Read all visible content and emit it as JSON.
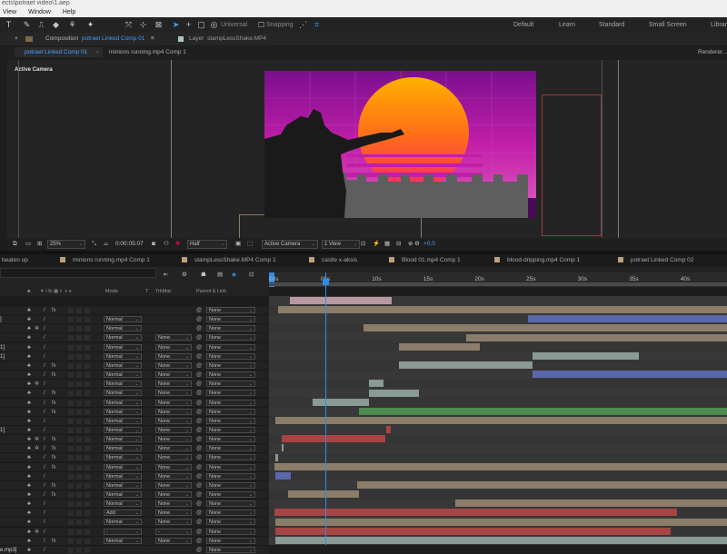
{
  "app": {
    "title": "ects\\potraet video\\1.aep",
    "menu": [
      "View",
      "Window",
      "Help"
    ]
  },
  "toolbar": {
    "universal_label": "Universal",
    "snapping_label": "Snapping",
    "workspaces": [
      "Default",
      "Learn",
      "Standard",
      "Small Screen",
      "Librar"
    ]
  },
  "panels": {
    "composition_tab": "Composition",
    "composition_name": "potraet Linked Comp 01",
    "layer_tab": "Layer",
    "layer_name": "stampLessShake.MP4",
    "sub_tabs": [
      "potraet Linked Comp 01",
      "minions running.mp4 Comp 1"
    ],
    "renderer": "Renderer..."
  },
  "viewer": {
    "active_camera_label": "Active Camera",
    "zoom": "25%",
    "timecode": "0:00:05:07",
    "resolution": "Half",
    "camera_select": "Active Camera",
    "view_select": "1 View",
    "exposure": "+0,0",
    "accent": "#2d8ceb"
  },
  "timeline": {
    "tabs": [
      "beaten up",
      "minions running.mp4 Comp 1",
      "stampLessShake.MP4 Comp 1",
      "castle x-aksis",
      "Blood 01.mp4 Comp 1",
      "blood-dripping.mp4 Comp 1",
      "potraet Linked Comp 02"
    ],
    "columns": {
      "mode": "Mode",
      "t": "T",
      "trkmat": "TrkMat",
      "parent": "Parent & Link"
    },
    "ruler_ticks": [
      "00s",
      "05s",
      "10s",
      "15s",
      "20s",
      "25s",
      "30s",
      "35s",
      "40s"
    ],
    "current_time_seconds": 5.2,
    "layers": [
      {
        "mode": "",
        "trkmat": "",
        "parent": "None",
        "left_label": "",
        "fx": true,
        "lock": false
      },
      {
        "mode": "Normal",
        "trkmat": "",
        "parent": "None",
        "left_label": "]",
        "fx": false,
        "lock": false
      },
      {
        "mode": "Normal",
        "trkmat": "",
        "parent": "None",
        "left_label": "",
        "fx": false,
        "lock": true
      },
      {
        "mode": "Normal",
        "trkmat": "None",
        "parent": "None",
        "left_label": "",
        "fx": false,
        "lock": false
      },
      {
        "mode": "Normal",
        "trkmat": "None",
        "parent": "None",
        "left_label": "1]",
        "fx": false,
        "lock": false
      },
      {
        "mode": "Normal",
        "trkmat": "None",
        "parent": "None",
        "left_label": "1]",
        "fx": false,
        "lock": false
      },
      {
        "mode": "Normal",
        "trkmat": "None",
        "parent": "None",
        "left_label": "",
        "fx": true,
        "lock": false
      },
      {
        "mode": "Normal",
        "trkmat": "None",
        "parent": "None",
        "left_label": "",
        "fx": true,
        "lock": false
      },
      {
        "mode": "Normal",
        "trkmat": "None",
        "parent": "None",
        "left_label": "",
        "fx": false,
        "lock": true
      },
      {
        "mode": "Normal",
        "trkmat": "None",
        "parent": "None",
        "left_label": "",
        "fx": true,
        "lock": false
      },
      {
        "mode": "Normal",
        "trkmat": "None",
        "parent": "None",
        "left_label": "",
        "fx": true,
        "lock": false
      },
      {
        "mode": "Normal",
        "trkmat": "None",
        "parent": "None",
        "left_label": "",
        "fx": true,
        "lock": false
      },
      {
        "mode": "Normal",
        "trkmat": "None",
        "parent": "None",
        "left_label": "",
        "fx": false,
        "lock": false
      },
      {
        "mode": "Normal",
        "trkmat": "None",
        "parent": "None",
        "left_label": "1]",
        "fx": false,
        "lock": false
      },
      {
        "mode": "Normal",
        "trkmat": "None",
        "parent": "None",
        "left_label": "",
        "fx": true,
        "lock": true
      },
      {
        "mode": "Normal",
        "trkmat": "None",
        "parent": "None",
        "left_label": "",
        "fx": true,
        "lock": true
      },
      {
        "mode": "Normal",
        "trkmat": "None",
        "parent": "None",
        "left_label": "",
        "fx": true,
        "lock": false
      },
      {
        "mode": "Normal",
        "trkmat": "None",
        "parent": "None",
        "left_label": "",
        "fx": true,
        "lock": false
      },
      {
        "mode": "Normal",
        "trkmat": "None",
        "parent": "None",
        "left_label": "",
        "fx": false,
        "lock": false
      },
      {
        "mode": "Normal",
        "trkmat": "None",
        "parent": "None",
        "left_label": "",
        "fx": true,
        "lock": false
      },
      {
        "mode": "Normal",
        "trkmat": "None",
        "parent": "None",
        "left_label": "",
        "fx": true,
        "lock": false
      },
      {
        "mode": "Normal",
        "trkmat": "None",
        "parent": "None",
        "left_label": "",
        "fx": false,
        "lock": false
      },
      {
        "mode": "Add",
        "trkmat": "None",
        "parent": "None",
        "left_label": "",
        "fx": false,
        "lock": false
      },
      {
        "mode": "Normal",
        "trkmat": "None",
        "parent": "None",
        "left_label": "",
        "fx": false,
        "lock": false
      },
      {
        "mode": "-",
        "trkmat": "-",
        "parent": "None",
        "left_label": "",
        "fx": false,
        "lock": true
      },
      {
        "mode": "Normal",
        "trkmat": "None",
        "parent": "None",
        "left_label": "",
        "fx": true,
        "lock": false
      },
      {
        "mode": "",
        "trkmat": "",
        "parent": "None",
        "left_label": "e.mp3]",
        "fx": false,
        "lock": false
      }
    ],
    "bars": [
      {
        "row": 0,
        "start": 1.7,
        "end": 11.6,
        "color": "#b898a0"
      },
      {
        "row": 1,
        "start": 0.5,
        "end": 45,
        "color": "#8b7d6a"
      },
      {
        "row": 2,
        "start": 24.8,
        "end": 45,
        "color": "#5968a8"
      },
      {
        "row": 3,
        "start": 8.8,
        "end": 45,
        "color": "#8b7d6a"
      },
      {
        "row": 4,
        "start": 18.8,
        "end": 45,
        "color": "#8b7d6a"
      },
      {
        "row": 5,
        "start": 12.3,
        "end": 20.2,
        "color": "#8b7d6a"
      },
      {
        "row": 6,
        "start": 25.3,
        "end": 35.6,
        "color": "#8a9a96"
      },
      {
        "row": 7,
        "start": 12.3,
        "end": 25.3,
        "color": "#8a9a96"
      },
      {
        "row": 8,
        "start": 25.3,
        "end": 45,
        "color": "#5968a8"
      },
      {
        "row": 9,
        "start": 9.4,
        "end": 10.8,
        "color": "#8a9a96"
      },
      {
        "row": 10,
        "start": 9.4,
        "end": 14.3,
        "color": "#8a9a96"
      },
      {
        "row": 11,
        "start": 3.9,
        "end": 9.4,
        "color": "#8a9a96"
      },
      {
        "row": 12,
        "start": 8.4,
        "end": 45,
        "color": "#4e8a4e"
      },
      {
        "row": 13,
        "start": 0.3,
        "end": 45,
        "color": "#8b7d6a"
      },
      {
        "row": 14,
        "start": 11,
        "end": 11.4,
        "color": "#a84444"
      },
      {
        "row": 15,
        "start": 0.9,
        "end": 11,
        "color": "#a84444"
      },
      {
        "row": 16,
        "start": 0.9,
        "end": 1.1,
        "color": "#8a9a96"
      },
      {
        "row": 17,
        "start": 0.3,
        "end": 0.6,
        "color": "#8a9a96"
      },
      {
        "row": 18,
        "start": 0.2,
        "end": 45,
        "color": "#8b7d6a"
      },
      {
        "row": 19,
        "start": 0.3,
        "end": 1.8,
        "color": "#5968a8"
      },
      {
        "row": 20,
        "start": 8.2,
        "end": 45,
        "color": "#8b7d6a"
      },
      {
        "row": 21,
        "start": 1.5,
        "end": 8.4,
        "color": "#8b7d6a"
      },
      {
        "row": 22,
        "start": 17.8,
        "end": 45,
        "color": "#8b7d6a"
      },
      {
        "row": 23,
        "start": 0.2,
        "end": 39.3,
        "color": "#a84444"
      },
      {
        "row": 24,
        "start": 0.3,
        "end": 45,
        "color": "#8b7d6a"
      },
      {
        "row": 25,
        "start": 0.3,
        "end": 38.7,
        "color": "#a84444"
      },
      {
        "row": 26,
        "start": 0.3,
        "end": 45,
        "color": "#8a9a96"
      }
    ]
  }
}
